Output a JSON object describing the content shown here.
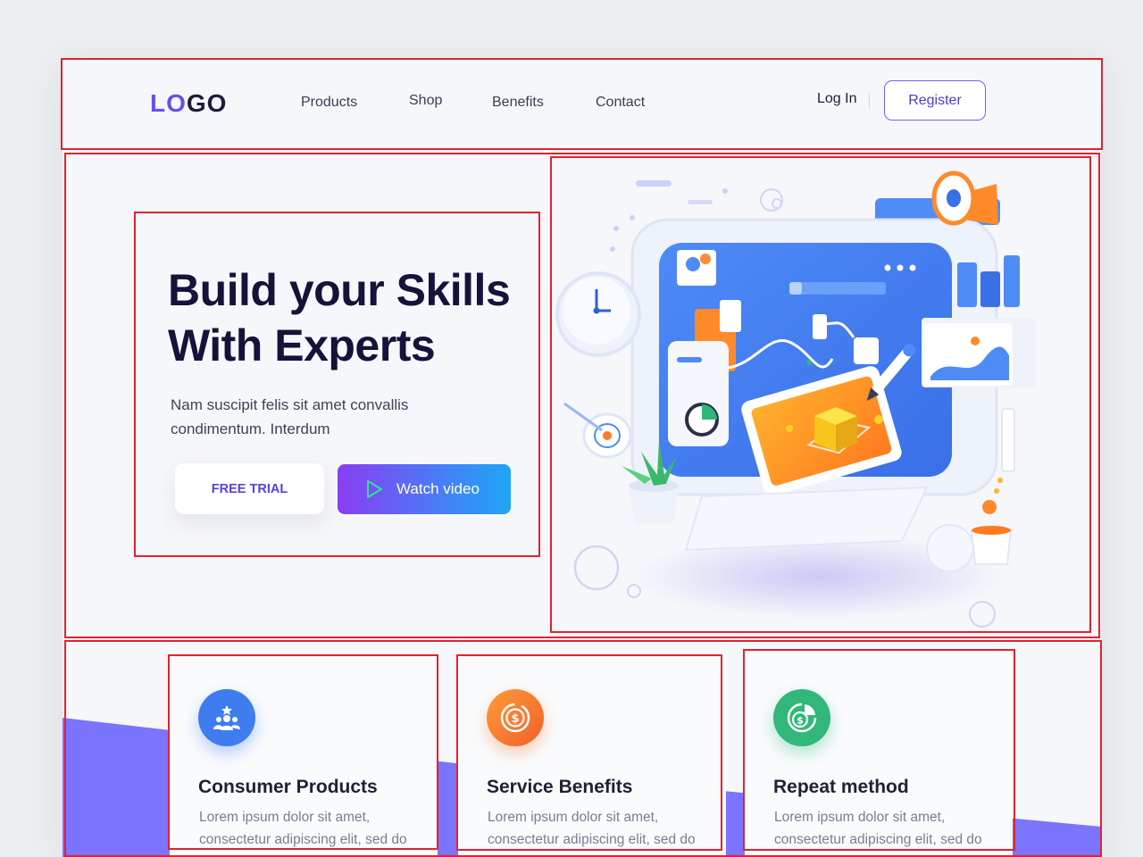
{
  "nav": {
    "logo_part1": "LO",
    "logo_part2": "GO",
    "links": [
      "Products",
      "Shop",
      "Benefits",
      "Contact"
    ],
    "login": "Log In",
    "register": "Register"
  },
  "hero": {
    "title_line1": "Build your Skills",
    "title_line2": "With Experts",
    "subtitle_line1": "Nam suscipit felis sit amet convallis",
    "subtitle_line2": "condimentum. Interdum",
    "free_trial": "FREE TRIAL",
    "watch_video": "Watch video"
  },
  "features": [
    {
      "title": "Consumer Products",
      "text": "Lorem ipsum dolor sit amet, consectetur adipiscing elit, sed do eiusmod tempor.",
      "icon": "users-star-icon",
      "color": "#3f7cf0"
    },
    {
      "title": "Service Benefits",
      "text": "Lorem ipsum dolor sit amet, consectetur adipiscing elit, sed do eiusmod tempor.",
      "icon": "dollar-coin-icon",
      "color": "#f47a2e"
    },
    {
      "title": "Repeat method",
      "text": "Lorem ipsum dolor sit amet, consectetur adipiscing elit, sed do eiusmod tempor.",
      "icon": "dollar-chart-icon",
      "color": "#2fb87a"
    }
  ],
  "colors": {
    "brand_purple": "#6a4cf5",
    "hero_title": "#14133a",
    "band_purple": "#7b74ff",
    "frame_red": "#e0232f"
  }
}
